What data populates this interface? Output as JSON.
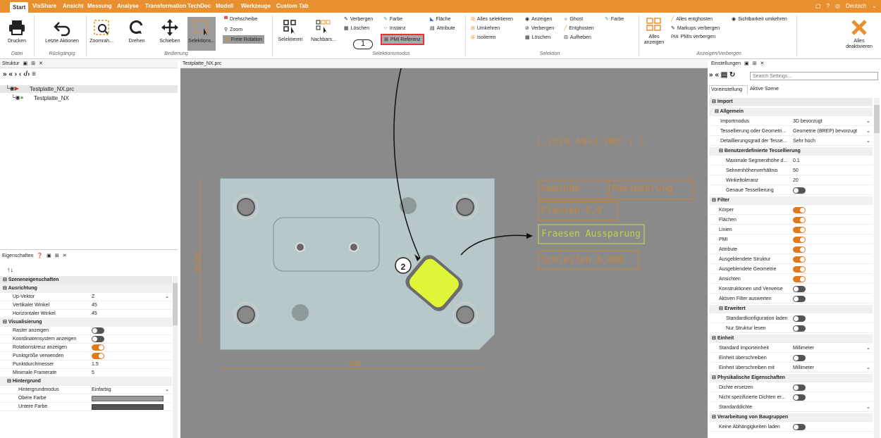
{
  "menu": {
    "tabs": [
      "Start",
      "VisShare",
      "Ansicht",
      "Messung",
      "Analyse",
      "Transformation",
      "TechDoc",
      "Modell",
      "Werkzeuge",
      "Custom Tab"
    ],
    "language": "Deutsch"
  },
  "ribbon": {
    "datei": {
      "drucken": "Drucken",
      "group": "Datei"
    },
    "rueck": {
      "letzte": "Letzte Aktionen",
      "group": "Rückgängig"
    },
    "bedienung": {
      "zoomrah": "Zoomrah...",
      "drehen": "Drehen",
      "schieben": "Schieben",
      "selektions": "Selektions...",
      "drehscheibe": "Drehscheibe",
      "zoom": "Zoom",
      "freie": "Freie Rotation",
      "group": "Bedienung"
    },
    "modus": {
      "selektieren": "Selektieren",
      "nachbars": "Nachbars...",
      "verbergen": "Verbergen",
      "loeschen": "Löschen",
      "farbe": "Farbe",
      "instanz": "Instanz",
      "pmi": "PMI Referenz",
      "flaeche": "Fläche",
      "attribute": "Attribute",
      "group": "Selektionsmodus"
    },
    "selektion": {
      "alles_sel": "Alles selektieren",
      "umkehren": "Umkehren",
      "isolieren": "Isolieren",
      "anzeigen": "Anzeigen",
      "verbergen": "Verbergen",
      "loeschen": "Löschen",
      "ghost": "Ghost",
      "entghosten": "Entghosten",
      "aufheben": "Aufheben",
      "farbe": "Farbe",
      "group": "Selektion"
    },
    "anzeigen": {
      "alles_anz": "Alles anzeigen",
      "alles_ent": "Alles entghosten",
      "markups": "Markups verbergen",
      "pmis": "PMIs verbergen",
      "sicht": "Sichtbarkeit umkehren",
      "group": "Anzeigen/Verbergen"
    },
    "deakt": "Alles deaktivieren"
  },
  "struktur": {
    "title": "Struktur",
    "items": [
      "Testplatte_NX.prc",
      "Testplatte_NX"
    ]
  },
  "viewport": {
    "tab": "Testplatte_NX.prc",
    "pmi_texts": [
      "1.2379 60+2 HRC ( )",
      "Gewinde",
      "Passbohrung",
      "Fraesen 0,0",
      "Fraesen Aussparung",
      "Schleifen 0,000"
    ],
    "dim_bottom": "100",
    "dim_left": "60,000",
    "callout1": "1",
    "callout2": "2"
  },
  "eigenschaften": {
    "title": "Eigenschaften",
    "sections": {
      "szene": "Szeneneigenschaften",
      "ausrichtung": "Ausrichtung",
      "visualisierung": "Visualisierung",
      "hintergrund": "Hintergrund"
    },
    "rows": {
      "upvektor": {
        "k": "Up-Vektor",
        "v": "Z"
      },
      "vertikal": {
        "k": "Vertikaler Winkel",
        "v": "45"
      },
      "horizontal": {
        "k": "Horizontaler Winkel",
        "v": "45"
      },
      "raster": "Raster anzeigen",
      "koord": "Koordinatensystem anzeigen",
      "rotkreuz": "Rotationskreuz anzeigen",
      "punktgr": "Punktgröße verwenden",
      "punktd": {
        "k": "Punktdurchmesser",
        "v": "1.5"
      },
      "framerate": {
        "k": "Minimale Framerate",
        "v": "5"
      },
      "hgmodus": {
        "k": "Hintergrundmodus",
        "v": "Einfarbig"
      },
      "obere": "Obere Farbe",
      "untere": "Untere Farbe"
    }
  },
  "einstellungen": {
    "title": "Einstellungen",
    "search_placeholder": "Search Settings...",
    "tabs": [
      "Voreinstellung",
      "Aktive Szene"
    ],
    "import": "Import",
    "allgemein": "Allgemein",
    "importmodus": {
      "k": "Importmodus",
      "v": "3D bevorzugt"
    },
    "tess": {
      "k": "Tessellierung oder Geometri...",
      "v": "Geometrie (BREP) bevorzugt"
    },
    "detail": {
      "k": "Detaillierungsgrad der Tesse...",
      "v": "Sehr hoch"
    },
    "benutz": "Benutzerdefinierte Tessellierung",
    "maxseg": {
      "k": "Maximale Segmenthöhe d...",
      "v": "0.1"
    },
    "sehnen": {
      "k": "Sehnenhöhenverhältnis",
      "v": "50"
    },
    "winkel": {
      "k": "Winkeltoleranz",
      "v": "20"
    },
    "genaue": "Genaue Tessellierung",
    "filter": "Filter",
    "filters": [
      "Körper",
      "Flächen",
      "Linien",
      "PMI",
      "Attribute",
      "Ausgeblendete Struktur",
      "Ausgeblendete Geometrie",
      "Ansichten",
      "Konstruktionen und Verweise",
      "Aktiven Filter auswerten"
    ],
    "erweitert": "Erweitert",
    "standardkonf": "Standardkonfiguration laden",
    "nurstruktur": "Nur Struktur lesen",
    "einheit": "Einheit",
    "stdimport": {
      "k": "Standard Importeinheit",
      "v": "Millimeter"
    },
    "einheitueb": "Einheit überschreiben",
    "einheitmit": {
      "k": "Einheit überschreiben mit",
      "v": "Millimeter"
    },
    "phys": "Physikalische Eigenschaften",
    "dichte": "Dichte ersetzen",
    "nichtspez": "Nicht spezifizierte Dichten er...",
    "standarddichte": "Standarddichte",
    "verarb": "Verarbeitung von Baugruppen",
    "keine": "Keine Abhängigkeiten laden"
  },
  "colors": {
    "accent": "#e8902f",
    "viewport_bg": "#8a8a8a",
    "plate": "#b7c8cb",
    "pmi": "#c6873e",
    "highlight": "#dff53a"
  }
}
